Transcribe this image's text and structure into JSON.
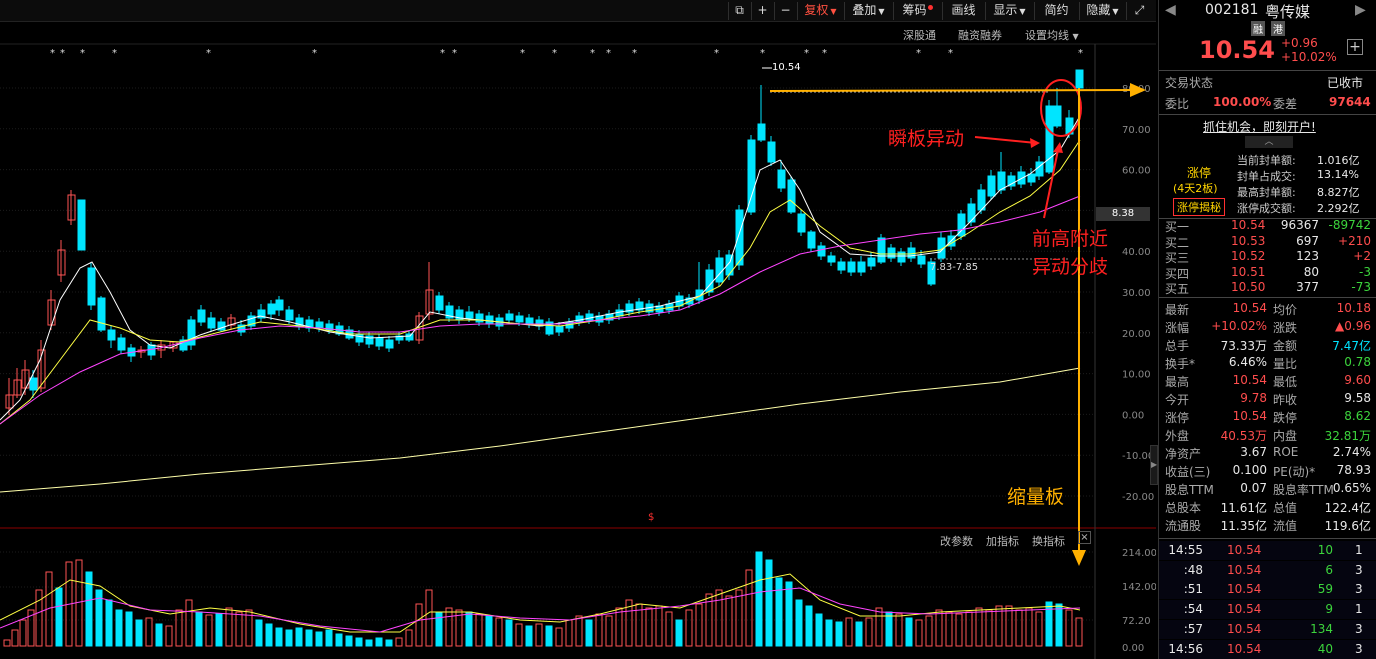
{
  "toolbar": {
    "buttons": [
      {
        "label": "复权",
        "caret": true
      },
      {
        "label": "叠加",
        "caret": true
      },
      {
        "label": "筹码"
      },
      {
        "label": "画线"
      },
      {
        "label": "显示",
        "caret": true
      },
      {
        "label": "简约"
      },
      {
        "label": "隐藏",
        "caret": true
      }
    ],
    "sub_buttons": [
      "深股通",
      "融资融券",
      "设置均线"
    ],
    "indicator_buttons": [
      "改参数",
      "加指标",
      "换指标"
    ]
  },
  "annotations": {
    "instant_board": "瞬板异动",
    "near_prev_high_line1": "前高附近",
    "near_prev_high_line2": "异动分歧",
    "shrink_volume_board": "缩量板",
    "high_label": "10.54",
    "range_label": "7.83-7.85",
    "current_level_label": "8.38",
    "dollar_mark": "$"
  },
  "price_axis": [
    "80.00",
    "70.00",
    "60.00",
    "50.00",
    "40.00",
    "30.00",
    "20.00",
    "10.00",
    "0.00",
    "-10.00",
    "-20.00"
  ],
  "volume_axis": [
    "214.00",
    "142.00",
    "72.20",
    "0.00"
  ],
  "stock": {
    "code": "002181",
    "name": "粤传媒",
    "badges": [
      "融",
      "港"
    ],
    "price": "10.54",
    "change": "+0.96",
    "change_pct": "+10.02%",
    "trade_status_label": "交易状态",
    "trade_status_value": "已收市",
    "wb_label": "委比",
    "wb_value": "100.00%",
    "wc_label": "委差",
    "wc_value": "97644",
    "promo": "抓住机会，即刻开户!"
  },
  "limit_up": {
    "title": "涨停",
    "streak": "(4天2板)",
    "button": "涨停揭秘",
    "stats": [
      {
        "label": "当前封单额:",
        "value": "1.016亿"
      },
      {
        "label": "封单占成交:",
        "value": "13.14%"
      },
      {
        "label": "最高封单额:",
        "value": "8.827亿"
      },
      {
        "label": "涨停成交额:",
        "value": "2.292亿"
      }
    ]
  },
  "order_book": [
    {
      "label": "买一",
      "price": "10.54",
      "vol": "96367",
      "chg": "-89742"
    },
    {
      "label": "买二",
      "price": "10.53",
      "vol": "697",
      "chg": "+210"
    },
    {
      "label": "买三",
      "price": "10.52",
      "vol": "123",
      "chg": "+2"
    },
    {
      "label": "买四",
      "price": "10.51",
      "vol": "80",
      "chg": "-3"
    },
    {
      "label": "买五",
      "price": "10.50",
      "vol": "377",
      "chg": "-73"
    }
  ],
  "quote_rows": [
    [
      {
        "l": "最新",
        "v": "10.54",
        "c": "red"
      },
      {
        "l": "均价",
        "v": "10.18",
        "c": "red"
      }
    ],
    [
      {
        "l": "涨幅",
        "v": "+10.02%",
        "c": "red"
      },
      {
        "l": "涨跌",
        "v": "▲0.96",
        "c": "red"
      }
    ],
    [
      {
        "l": "总手",
        "v": "73.33万",
        "c": "white"
      },
      {
        "l": "金额",
        "v": "7.47亿",
        "c": "cyan"
      }
    ],
    [
      {
        "l": "换手*",
        "v": "6.46%",
        "c": "white"
      },
      {
        "l": "量比",
        "v": "0.78",
        "c": "green"
      }
    ],
    [
      {
        "l": "最高",
        "v": "10.54",
        "c": "red"
      },
      {
        "l": "最低",
        "v": "9.60",
        "c": "red"
      }
    ],
    [
      {
        "l": "今开",
        "v": "9.78",
        "c": "red"
      },
      {
        "l": "昨收",
        "v": "9.58",
        "c": "white"
      }
    ],
    [
      {
        "l": "涨停",
        "v": "10.54",
        "c": "red"
      },
      {
        "l": "跌停",
        "v": "8.62",
        "c": "green"
      }
    ],
    [
      {
        "l": "外盘",
        "v": "40.53万",
        "c": "red"
      },
      {
        "l": "内盘",
        "v": "32.81万",
        "c": "green"
      }
    ],
    [
      {
        "l": "净资产",
        "v": "3.67",
        "c": "white"
      },
      {
        "l": "ROE",
        "v": "2.74%",
        "c": "white"
      }
    ],
    [
      {
        "l": "收益(三)",
        "v": "0.100",
        "c": "white"
      },
      {
        "l": "PE(动)*",
        "v": "78.93",
        "c": "white"
      }
    ],
    [
      {
        "l": "股息TTM",
        "v": "0.07",
        "c": "white"
      },
      {
        "l": "股息率TTM",
        "v": "0.65%",
        "c": "white"
      }
    ],
    [
      {
        "l": "总股本",
        "v": "11.61亿",
        "c": "white"
      },
      {
        "l": "总值",
        "v": "122.4亿",
        "c": "white"
      }
    ],
    [
      {
        "l": "流通股",
        "v": "11.35亿",
        "c": "white"
      },
      {
        "l": "流值",
        "v": "119.6亿",
        "c": "white"
      }
    ]
  ],
  "ticks": [
    {
      "time": "14:55",
      "price": "10.54",
      "vol": "10",
      "n": "1"
    },
    {
      "time": ":48",
      "price": "10.54",
      "vol": "6",
      "n": "3"
    },
    {
      "time": ":51",
      "price": "10.54",
      "vol": "59",
      "n": "3"
    },
    {
      "time": ":54",
      "price": "10.54",
      "vol": "9",
      "n": "1"
    },
    {
      "time": ":57",
      "price": "10.54",
      "vol": "134",
      "n": "3"
    },
    {
      "time": "14:56",
      "price": "10.54",
      "vol": "40",
      "n": "3"
    }
  ],
  "colors": {
    "up": "#ff5555",
    "down": "#00e5ff",
    "ma5": "#ffffff",
    "ma10": "#ffff44",
    "ma20": "#ff44ff",
    "ma_long": "#ffffaa",
    "annotation_red": "#ff2020",
    "annotation_orange": "#ffb000"
  }
}
